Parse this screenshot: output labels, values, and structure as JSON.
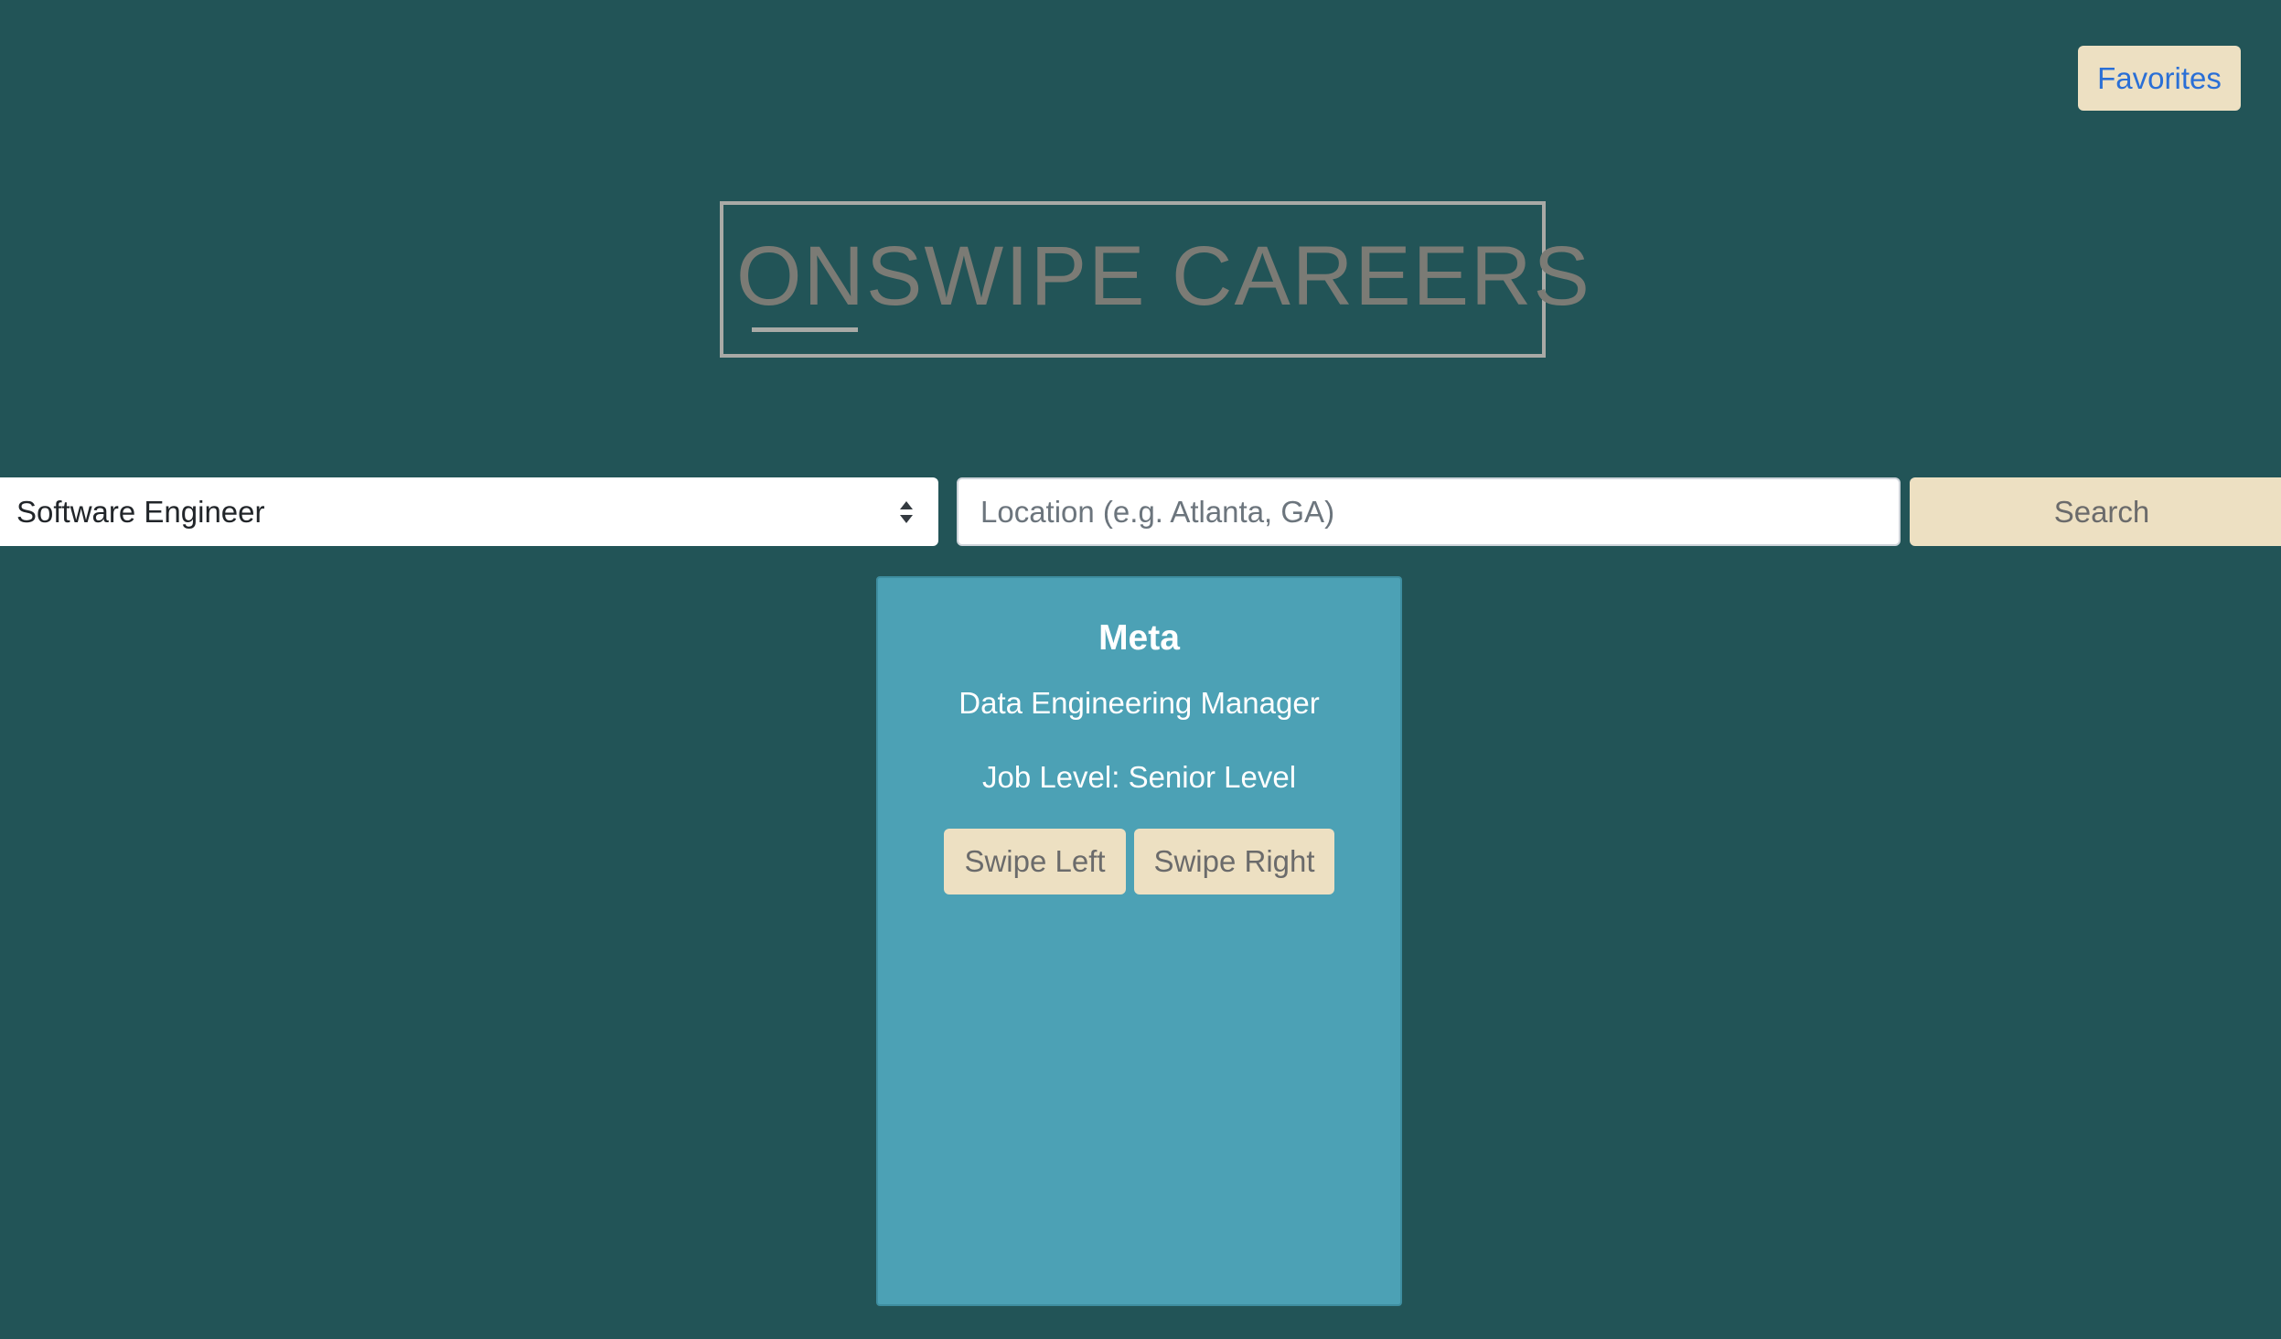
{
  "colors": {
    "page_background": "#225457",
    "card_background": "#4ca1b5",
    "button_background": "#ede0c2",
    "button_text": "#6b6b6b",
    "favorites_text": "#2a6fd6",
    "logo_text": "#7b7b75",
    "logo_border": "#a9aaa6",
    "select_text": "#212529"
  },
  "header": {
    "favorites_label": "Favorites"
  },
  "logo": {
    "text": "ONSWIPE CAREERS"
  },
  "search": {
    "job_select_value": "Software Engineer",
    "location_placeholder": "Location (e.g. Atlanta, GA)",
    "location_value": "",
    "search_label": "Search"
  },
  "card": {
    "company": "Meta",
    "title": "Data Engineering Manager",
    "level": "Job Level: Senior Level",
    "swipe_left_label": "Swipe Left",
    "swipe_right_label": "Swipe Right"
  }
}
